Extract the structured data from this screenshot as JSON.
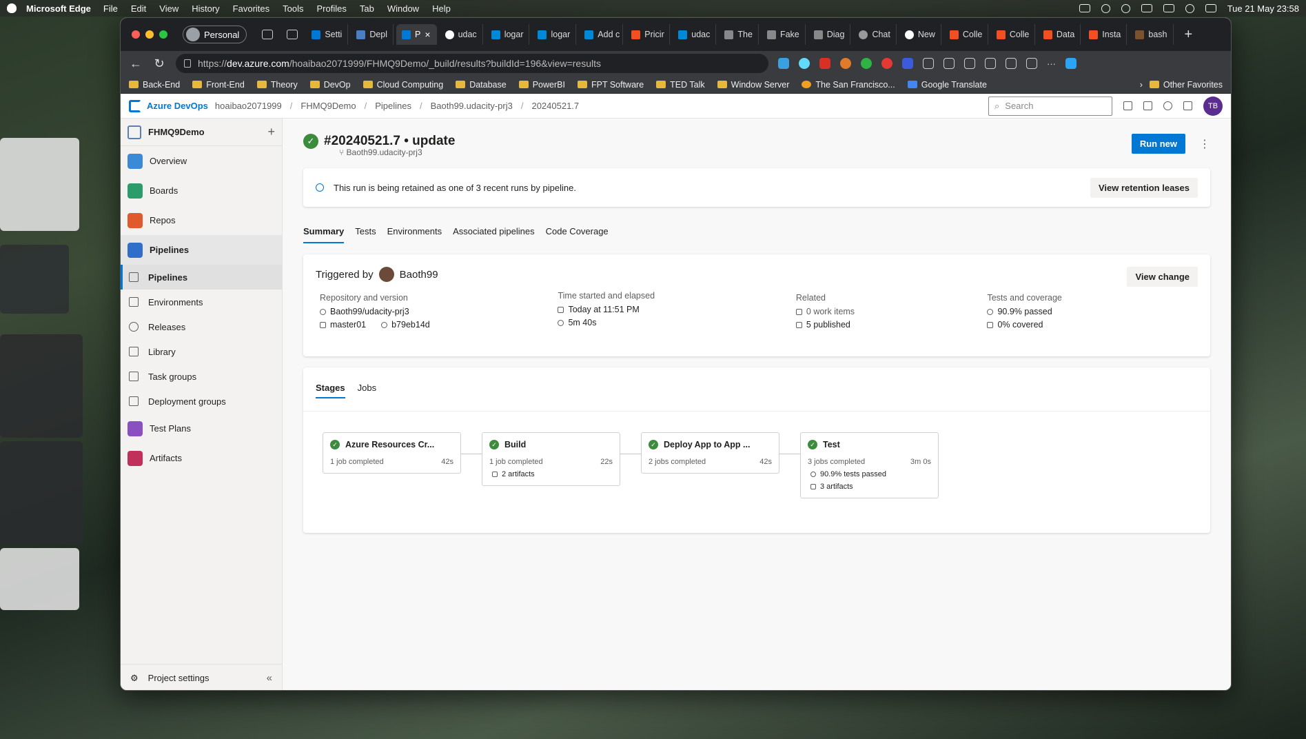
{
  "menubar": {
    "app": "Microsoft Edge",
    "items": [
      "File",
      "Edit",
      "View",
      "History",
      "Favorites",
      "Tools",
      "Profiles",
      "Tab",
      "Window",
      "Help"
    ],
    "datetime": "Tue 21 May  23:58"
  },
  "browser": {
    "profile": "Personal",
    "tabs": [
      "Setti",
      "Depl",
      "P",
      "udac",
      "logar",
      "logar",
      "Add c",
      "Pricir",
      "udac",
      "The",
      "Fake",
      "Diag",
      "Chat",
      "New",
      "Colle",
      "Colle",
      "Data",
      "Insta",
      "bash"
    ],
    "active_tab_index": 2,
    "url_prefix": "https://",
    "url_host": "dev.azure.com",
    "url_path": "/hoaibao2071999/FHMQ9Demo/_build/results?buildId=196&view=results",
    "bookmarks": [
      "Back-End",
      "Front-End",
      "Theory",
      "DevOp",
      "Cloud Computing",
      "Database",
      "PowerBI",
      "FPT Software",
      "TED Talk",
      "Window Server",
      "The San Francisco...",
      "Google Translate"
    ],
    "other_favorites": "Other Favorites"
  },
  "ado": {
    "brand": "Azure DevOps",
    "breadcrumbs": [
      "hoaibao2071999",
      "FHMQ9Demo",
      "Pipelines",
      "Baoth99.udacity-prj3",
      "20240521.7"
    ],
    "search_placeholder": "Search",
    "user_initials": "TB"
  },
  "sidebar": {
    "project": "FHMQ9Demo",
    "items": [
      {
        "label": "Overview",
        "color": "#3b8ad8"
      },
      {
        "label": "Boards",
        "color": "#2a9d6a"
      },
      {
        "label": "Repos",
        "color": "#e05a2b"
      },
      {
        "label": "Pipelines",
        "color": "#2f6fc9"
      }
    ],
    "pipeline_sub": [
      "Pipelines",
      "Environments",
      "Releases",
      "Library",
      "Task groups",
      "Deployment groups"
    ],
    "after": [
      {
        "label": "Test Plans",
        "color": "#8a4fc0"
      },
      {
        "label": "Artifacts",
        "color": "#c0305a"
      }
    ],
    "project_settings": "Project settings"
  },
  "run": {
    "title": "#20240521.7 • update",
    "pipeline": "Baoth99.udacity-prj3",
    "run_new": "Run new",
    "banner": "This run is being retained as one of 3 recent runs by pipeline.",
    "retention_button": "View retention leases",
    "tabs": [
      "Summary",
      "Tests",
      "Environments",
      "Associated pipelines",
      "Code Coverage"
    ],
    "triggered_by_label": "Triggered by",
    "triggered_by_user": "Baoth99",
    "view_change": "View change",
    "repo": {
      "label": "Repository and version",
      "name": "Baoth99/udacity-prj3",
      "branch": "master01",
      "commit": "b79eb14d"
    },
    "time": {
      "label": "Time started and elapsed",
      "started": "Today at 11:51 PM",
      "elapsed": "5m 40s"
    },
    "related": {
      "label": "Related",
      "work_items": "0 work items",
      "published": "5 published"
    },
    "tests": {
      "label": "Tests and coverage",
      "passed": "90.9% passed",
      "covered": "0% covered"
    },
    "stage_tabs": [
      "Stages",
      "Jobs"
    ],
    "stages": [
      {
        "name": "Azure Resources Cr...",
        "jobs": "1 job completed",
        "duration": "42s",
        "extras": []
      },
      {
        "name": "Build",
        "jobs": "1 job completed",
        "duration": "22s",
        "extras": [
          "2 artifacts"
        ]
      },
      {
        "name": "Deploy App to App ...",
        "jobs": "2 jobs completed",
        "duration": "42s",
        "extras": []
      },
      {
        "name": "Test",
        "jobs": "3 jobs completed",
        "duration": "3m 0s",
        "extras": [
          "90.9% tests passed",
          "3 artifacts"
        ]
      }
    ]
  }
}
